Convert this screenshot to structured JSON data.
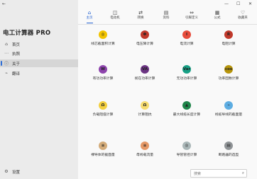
{
  "window": {
    "minimize": "—",
    "maximize": "☐",
    "close": "✕"
  },
  "sidebar": {
    "title": "电工计算器 PRO",
    "items": [
      {
        "icon": "⌂",
        "label": "首页"
      },
      {
        "icon": "⋯",
        "label": "执照"
      },
      {
        "icon": "ⓘ",
        "label": "关于"
      },
      {
        "icon": "⌁",
        "label": "翻译"
      }
    ],
    "settings": {
      "icon": "⚙",
      "label": "设置"
    }
  },
  "tabs": [
    {
      "icon": "⌂",
      "label": "主页"
    },
    {
      "icon": "◫",
      "label": "电动机"
    },
    {
      "icon": "⇄",
      "label": "转换"
    },
    {
      "icon": "▤",
      "label": "资料"
    },
    {
      "icon": "⇔",
      "label": "引脚定义"
    },
    {
      "icon": "▦",
      "label": "公式"
    },
    {
      "icon": "♡",
      "label": "收藏夹"
    }
  ],
  "tiles": [
    {
      "label": "线芯截面积计算",
      "glyph": "◎",
      "color": "#f2c400"
    },
    {
      "label": "电压降计算",
      "glyph": "Φ",
      "color": "#c0392b"
    },
    {
      "label": "电流计算",
      "glyph": "I",
      "color": "#e74c3c"
    },
    {
      "label": "电阻计算",
      "glyph": "R",
      "color": "#c0392b"
    },
    {
      "label": "有功功率计算",
      "glyph": "W",
      "color": "#8e44ad"
    },
    {
      "label": "视在功率计算",
      "glyph": "VA",
      "color": "#6c3483"
    },
    {
      "label": "无功功率计算",
      "glyph": "Var",
      "color": "#16a085"
    },
    {
      "label": "功率因数计算",
      "glyph": "cos",
      "color": "#b7950b"
    },
    {
      "label": "负载阻值计算",
      "glyph": "Ω",
      "color": "#f4d03f"
    },
    {
      "label": "计算阻抗",
      "glyph": "Ω",
      "color": "#f7dc6f"
    },
    {
      "label": "最大线缆长度计算",
      "glyph": "▲",
      "color": "#1e8449"
    },
    {
      "label": "线缆导线的截面量",
      "glyph": "⌁",
      "color": "#5dade2"
    },
    {
      "label": "裸导体的截面量",
      "glyph": "≡",
      "color": "#d4ac7a"
    },
    {
      "label": "母线载流量",
      "glyph": "≡",
      "color": "#e59866"
    },
    {
      "label": "导管管径计算",
      "glyph": "◎",
      "color": "#aab7b8"
    },
    {
      "label": "断路器的选型",
      "glyph": "▤",
      "color": "#909497"
    }
  ],
  "search": {
    "placeholder": "搜索",
    "icon": "⌕"
  }
}
